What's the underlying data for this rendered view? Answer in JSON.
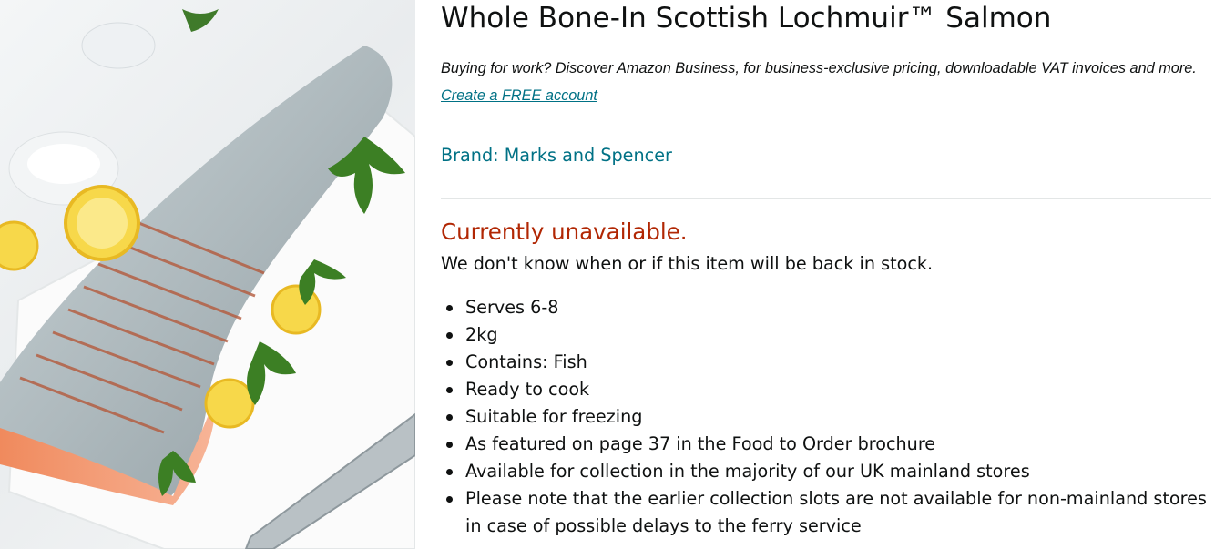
{
  "product": {
    "title": "Whole Bone-In Scottish Lochmuir™ Salmon",
    "business_text": "Buying for work? Discover Amazon Business, for business-exclusive pricing, downloadable VAT invoices and more.",
    "business_link": "Create a FREE account",
    "brand": "Brand: Marks and Spencer",
    "availability": "Currently unavailable.",
    "stock_note": "We don't know when or if this item will be back in stock.",
    "features": [
      "Serves 6-8",
      "2kg",
      "Contains: Fish",
      "Ready to cook",
      "Suitable for freezing",
      "As featured on page 37 in the Food to Order brochure",
      "Available for collection in the majority of our UK mainland stores",
      "Please note that the earlier collection slots are not available for non-mainland stores in case of possible delays to the ferry service"
    ]
  },
  "colors": {
    "link": "#007185",
    "availability": "#b12704",
    "text": "#0f1111"
  }
}
